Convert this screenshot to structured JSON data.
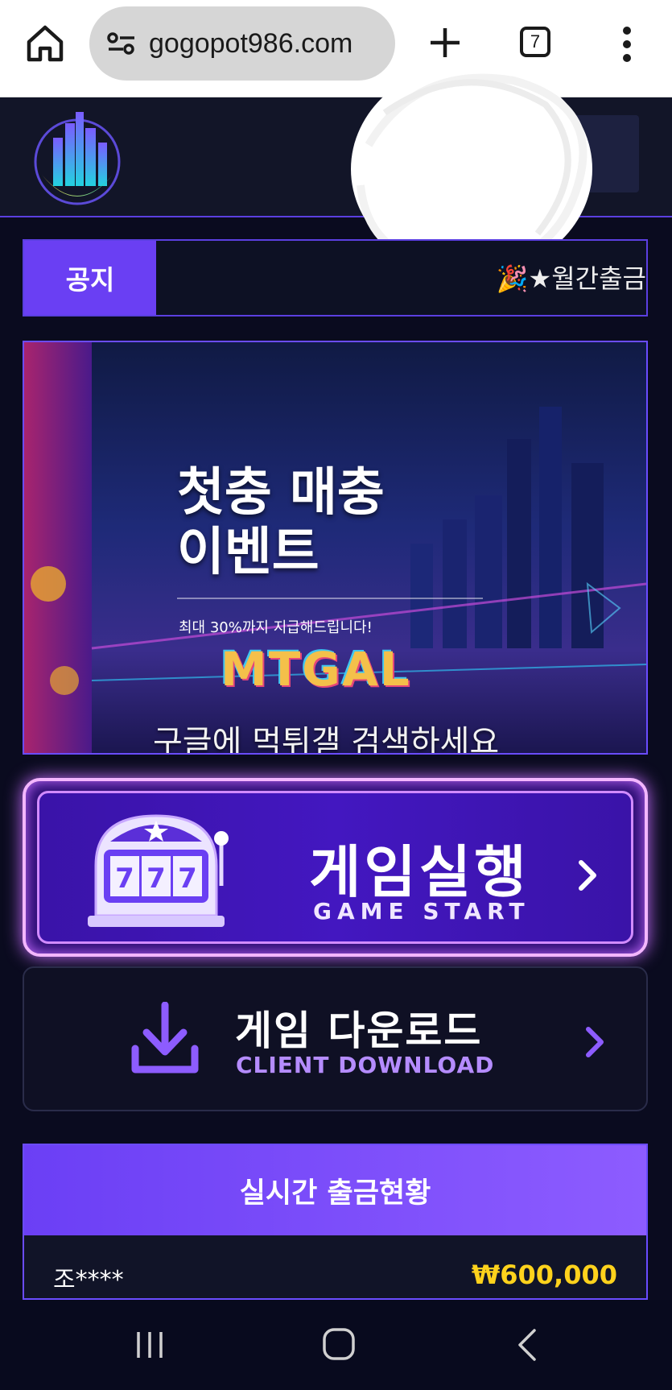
{
  "browser": {
    "url": "gogopot986.com",
    "tab_count": "7"
  },
  "notice": {
    "label": "공지",
    "ticker_text": "🎉★월간출금"
  },
  "banner": {
    "title": "첫충 매충\n이벤트",
    "subtitle": "최대 30%까지 지급해드립니다!",
    "brand": "MTGAL",
    "search_text": "구글에 먹튀갤 검색하세요"
  },
  "game_start": {
    "title": "게임실행",
    "subtitle": "GAME START",
    "slot_digits": "777"
  },
  "download": {
    "title": "게임 다운로드",
    "subtitle": "CLIENT DOWNLOAD"
  },
  "withdrawals": {
    "header": "실시간 출금현황",
    "rows": [
      {
        "name": "조****",
        "amount": "₩600,000"
      }
    ]
  },
  "colors": {
    "accent": "#6a3ff3",
    "page_bg": "#0a0b1f",
    "amount": "#ffd21c"
  }
}
